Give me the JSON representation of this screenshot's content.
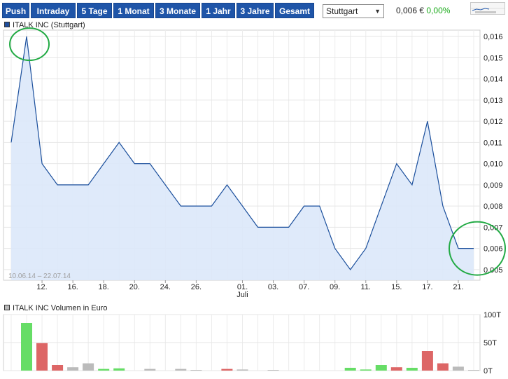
{
  "toolbar": {
    "tabs": [
      "Push",
      "Intraday",
      "5 Tage",
      "1 Monat",
      "3 Monate",
      "1 Jahr",
      "3 Jahre",
      "Gesamt"
    ],
    "exchange_selected": "Stuttgart",
    "price": "0,006 €",
    "change": "0,00%",
    "colors": {
      "tab_bg": "#1f55a8",
      "change": "#1aaa1a"
    }
  },
  "chart_data": [
    {
      "type": "area",
      "legend": "ITALK INC (Stuttgart)",
      "date_range_label": "10.06.14 – 22.07.14",
      "x_tick_labels": [
        "12.",
        "16.",
        "18.",
        "20.",
        "24.",
        "26.",
        "01.",
        "03.",
        "07.",
        "09.",
        "11.",
        "15.",
        "17.",
        "21."
      ],
      "x_month_label": "Juli",
      "y_tick_labels": [
        "0,016",
        "0,015",
        "0,014",
        "0,013",
        "0,012",
        "0,011",
        "0,010",
        "0,009",
        "0,008",
        "0,007",
        "0,006",
        "0,005"
      ],
      "ylim": [
        0.0045,
        0.0163
      ],
      "x": [
        "10.06.",
        "11.06.",
        "12.06.",
        "13.06.",
        "16.06.",
        "17.06.",
        "18.06.",
        "19.06.",
        "20.06.",
        "23.06.",
        "24.06.",
        "25.06.",
        "26.06.",
        "27.06.",
        "30.06.",
        "01.07.",
        "02.07.",
        "03.07.",
        "04.07.",
        "07.07.",
        "08.07.",
        "09.07.",
        "10.07.",
        "11.07.",
        "14.07.",
        "15.07.",
        "16.07.",
        "17.07.",
        "18.07.",
        "21.07.",
        "22.07."
      ],
      "series": [
        {
          "values": [
            0.011,
            0.016,
            0.01,
            0.009,
            0.009,
            0.009,
            0.01,
            0.011,
            0.01,
            0.01,
            0.009,
            0.008,
            0.008,
            0.008,
            0.009,
            0.008,
            0.007,
            0.007,
            0.007,
            0.008,
            0.008,
            0.006,
            0.005,
            0.006,
            0.008,
            0.01,
            0.009,
            0.012,
            0.008,
            0.006,
            0.006
          ],
          "line_color": "#1b4f9c",
          "fill_color": "#dbe8fa"
        }
      ],
      "grid": true,
      "annotations": [
        "green circle around peak",
        "green circle around last value"
      ]
    },
    {
      "type": "bar",
      "legend": "ITALK INC Volumen in Euro",
      "y_tick_labels": [
        "100T",
        "50T",
        "0T"
      ],
      "ylim": [
        0,
        100000
      ],
      "values": [
        85000,
        49000,
        10000,
        6000,
        13000,
        3000,
        4000,
        0,
        3000,
        0,
        3000,
        1000,
        0,
        3000,
        2000,
        0,
        1000,
        0,
        0,
        0,
        0,
        5000,
        2000,
        10000,
        6000,
        5000,
        35000,
        13000,
        7000,
        1000
      ],
      "colors": [
        "#66dd66",
        "#dd6666",
        "#dd6666",
        "#bbbbbb",
        "#bbbbbb",
        "#66dd66",
        "#66dd66",
        "#bbbbbb",
        "#bbbbbb",
        "#dd6666",
        "#bbbbbb",
        "#bbbbbb",
        "#66dd66",
        "#dd6666",
        "#bbbbbb",
        "#bbbbbb",
        "#bbbbbb",
        "#bbbbbb",
        "#bbbbbb",
        "#bbbbbb",
        "#dd6666",
        "#66dd66",
        "#66dd66",
        "#66dd66",
        "#dd6666",
        "#66dd66",
        "#dd6666",
        "#dd6666",
        "#bbbbbb",
        "#bbbbbb"
      ],
      "grid": true
    }
  ]
}
